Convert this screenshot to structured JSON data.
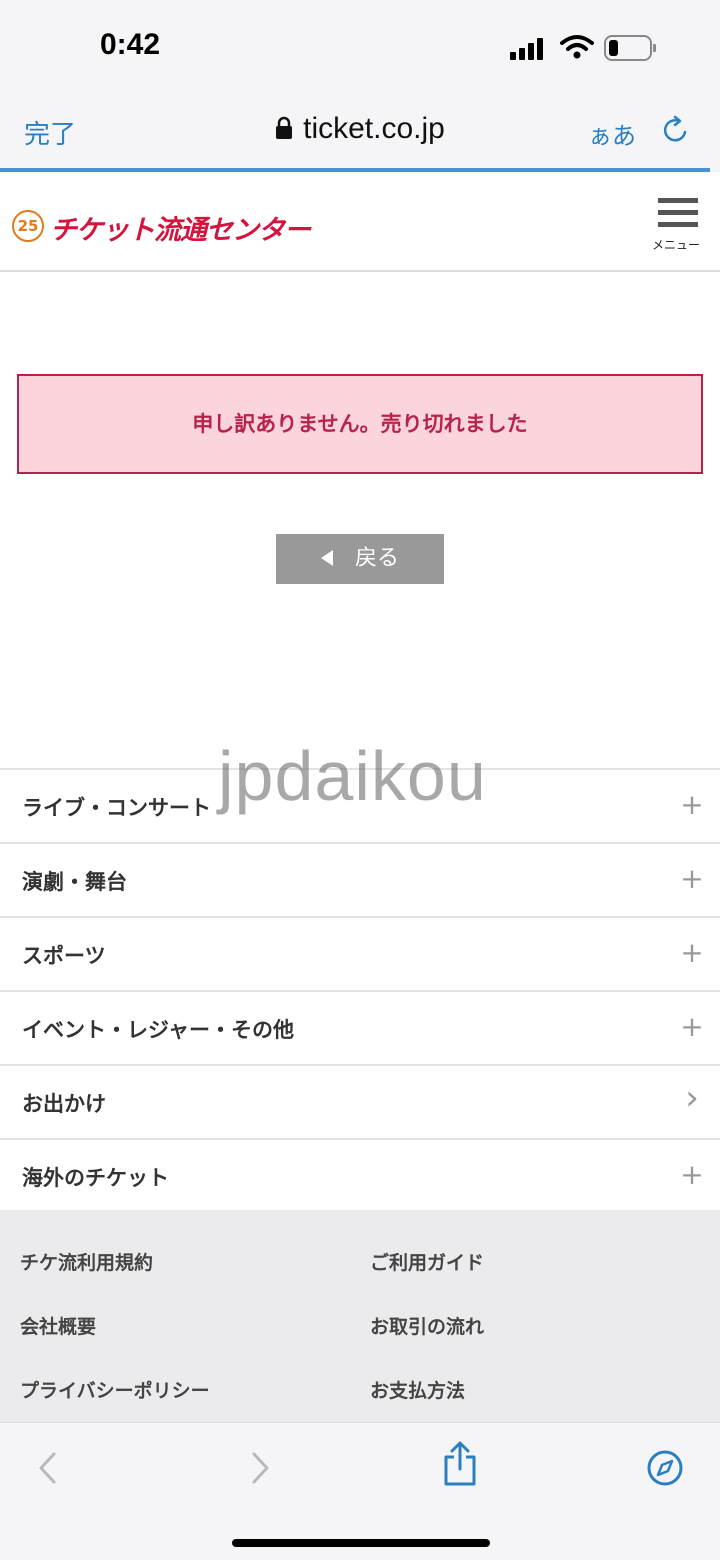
{
  "status_bar": {
    "time": "0:42",
    "icons": [
      "signal-icon",
      "wifi-icon",
      "battery-icon"
    ]
  },
  "browser": {
    "done_label": "完了",
    "url": "ticket.co.jp",
    "aa_label": "ぁあ",
    "icons": [
      "lock-icon",
      "reload-icon"
    ],
    "accent_color": "#2a7fc1"
  },
  "site_header": {
    "logo_badge": "25",
    "logo_text": "チケット流通センター",
    "menu_label": "メニュー",
    "brand_color": "#d4143c"
  },
  "main": {
    "alert_message": "申し訳ありません。売り切れました",
    "back_label": "戻る"
  },
  "categories": [
    {
      "label": "ライブ・コンサート",
      "icon": "+"
    },
    {
      "label": "演劇・舞台",
      "icon": "+"
    },
    {
      "label": "スポーツ",
      "icon": "+"
    },
    {
      "label": "イベント・レジャー・その他",
      "icon": "+"
    },
    {
      "label": "お出かけ",
      "icon": "›"
    },
    {
      "label": "海外のチケット",
      "icon": "+"
    }
  ],
  "footer": {
    "links": [
      "チケ流利用規約",
      "ご利用ガイド",
      "会社概要",
      "お取引の流れ",
      "プライバシーポリシー",
      "お支払方法"
    ]
  },
  "watermark": "jpdaikou",
  "toolbar": {
    "icons": [
      "back-icon",
      "forward-icon",
      "share-icon",
      "compass-icon"
    ]
  }
}
